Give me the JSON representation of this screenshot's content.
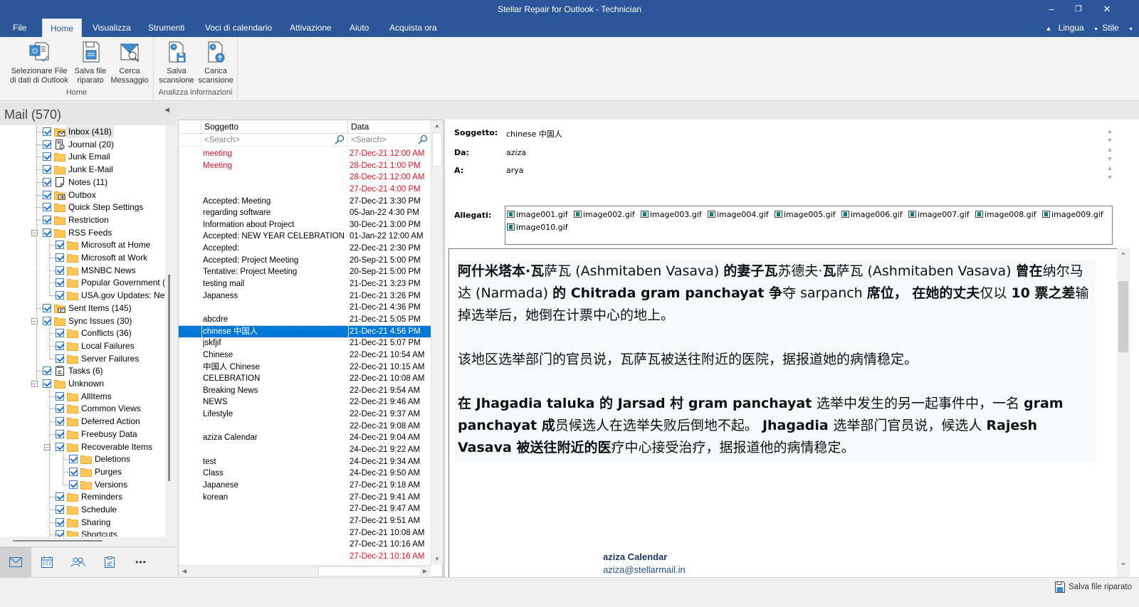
{
  "window": {
    "title": "Stellar Repair for Outlook - Technician",
    "minimize": "–",
    "restore": "❐",
    "close": "✕"
  },
  "menu": {
    "tabs": [
      {
        "label": "File",
        "active": false
      },
      {
        "label": "Home",
        "active": true
      },
      {
        "label": "Visualizza",
        "active": false
      },
      {
        "label": "Strumenti",
        "active": false
      },
      {
        "label": "Voci di calendario",
        "active": false
      },
      {
        "label": "Attivazione",
        "active": false
      },
      {
        "label": "Aiuto",
        "active": false
      },
      {
        "label": "Acquista ora",
        "active": false
      }
    ],
    "right": {
      "lingua": "Lingua",
      "stile": "Stile"
    }
  },
  "ribbon": {
    "groups": [
      {
        "label": "Home",
        "buttons": [
          {
            "line1": "Selezionare File",
            "line2": "di dati di Outlook",
            "icon": "outlook-file-icon"
          },
          {
            "line1": "Salva file",
            "line2": "riparato",
            "icon": "save-file-icon"
          },
          {
            "line1": "Cerca",
            "line2": "Messaggio",
            "icon": "search-message-icon"
          }
        ]
      },
      {
        "label": "Analizza informazioni",
        "buttons": [
          {
            "line1": "Salva",
            "line2": "scansione",
            "icon": "save-scan-icon"
          },
          {
            "line1": "Carica",
            "line2": "scansione",
            "icon": "load-scan-icon"
          }
        ]
      }
    ]
  },
  "left": {
    "header": "Mail (570)",
    "tree": [
      {
        "label": "Inbox (418)",
        "level": 1,
        "icon": "inbox-folder-icon",
        "selected": true
      },
      {
        "label": "Journal (20)",
        "level": 1,
        "icon": "journal-icon"
      },
      {
        "label": "Junk Email",
        "level": 1,
        "icon": "folder-icon"
      },
      {
        "label": "Junk E-Mail",
        "level": 1,
        "icon": "folder-icon"
      },
      {
        "label": "Notes (11)",
        "level": 1,
        "icon": "notes-icon"
      },
      {
        "label": "Outbox",
        "level": 1,
        "icon": "outbox-folder-icon"
      },
      {
        "label": "Quick Step Settings",
        "level": 1,
        "icon": "folder-icon"
      },
      {
        "label": "Restriction",
        "level": 1,
        "icon": "folder-icon"
      },
      {
        "label": "RSS Feeds",
        "level": 1,
        "icon": "folder-icon",
        "expanded": true
      },
      {
        "label": "Microsoft at Home",
        "level": 2,
        "icon": "folder-icon"
      },
      {
        "label": "Microsoft at Work",
        "level": 2,
        "icon": "folder-icon"
      },
      {
        "label": "MSNBC News",
        "level": 2,
        "icon": "folder-icon"
      },
      {
        "label": "Popular Government (",
        "level": 2,
        "icon": "folder-icon"
      },
      {
        "label": "USA.gov Updates: New",
        "level": 2,
        "icon": "folder-icon"
      },
      {
        "label": "Sent Items (145)",
        "level": 1,
        "icon": "sent-folder-icon"
      },
      {
        "label": "Sync Issues (30)",
        "level": 1,
        "icon": "folder-icon",
        "expanded": true
      },
      {
        "label": "Conflicts (36)",
        "level": 2,
        "icon": "folder-icon"
      },
      {
        "label": "Local Failures",
        "level": 2,
        "icon": "folder-icon"
      },
      {
        "label": "Server Failures",
        "level": 2,
        "icon": "folder-icon"
      },
      {
        "label": "Tasks (6)",
        "level": 1,
        "icon": "tasks-icon"
      },
      {
        "label": "Unknown",
        "level": 1,
        "icon": "folder-icon",
        "expanded": true
      },
      {
        "label": "AllItems",
        "level": 2,
        "icon": "folder-icon"
      },
      {
        "label": "Common Views",
        "level": 2,
        "icon": "folder-icon"
      },
      {
        "label": "Deferred Action",
        "level": 2,
        "icon": "folder-icon"
      },
      {
        "label": "Freebusy Data",
        "level": 2,
        "icon": "folder-icon"
      },
      {
        "label": "Recoverable Items",
        "level": 2,
        "icon": "folder-icon",
        "expanded": true
      },
      {
        "label": "Deletions",
        "level": 3,
        "icon": "folder-icon"
      },
      {
        "label": "Purges",
        "level": 3,
        "icon": "folder-icon"
      },
      {
        "label": "Versions",
        "level": 3,
        "icon": "folder-icon"
      },
      {
        "label": "Reminders",
        "level": 2,
        "icon": "folder-icon"
      },
      {
        "label": "Schedule",
        "level": 2,
        "icon": "folder-icon"
      },
      {
        "label": "Sharing",
        "level": 2,
        "icon": "folder-icon"
      },
      {
        "label": "Shortcuts",
        "level": 2,
        "icon": "folder-icon"
      }
    ],
    "nav": [
      "mail-icon",
      "calendar-icon",
      "contacts-icon",
      "tasks-icon",
      "more-icon"
    ],
    "more_label": "•••"
  },
  "list": {
    "columns": {
      "subject": "Soggetto",
      "date": "Data"
    },
    "search_placeholder": "<Search>",
    "rows": [
      {
        "subject": "meeting",
        "date": "27-Dec-21 12:00 AM",
        "red": true
      },
      {
        "subject": "Meeting",
        "date": "28-Dec-21 1:00 PM",
        "red": true
      },
      {
        "subject": "",
        "date": "28-Dec-21 12:00 AM",
        "red": true
      },
      {
        "subject": "",
        "date": "27-Dec-21 4:00 PM",
        "red": true
      },
      {
        "subject": "Accepted: Meeting",
        "date": "27-Dec-21 3:30 PM"
      },
      {
        "subject": "regarding software",
        "date": "05-Jan-22 4:30 PM"
      },
      {
        "subject": "Information about Project",
        "date": "30-Dec-21 3:00 PM"
      },
      {
        "subject": "Accepted: NEW YEAR CELEBRATION",
        "date": "01-Jan-22 12:00 AM"
      },
      {
        "subject": "Accepted:",
        "date": "22-Dec-21 2:30 PM"
      },
      {
        "subject": "Accepted: Project Meeting",
        "date": "20-Sep-21 5:00 PM"
      },
      {
        "subject": "Tentative: Project Meeting",
        "date": "20-Sep-21 5:00 PM"
      },
      {
        "subject": "testing mail",
        "date": "21-Dec-21 3:23 PM"
      },
      {
        "subject": "Japaness",
        "date": "21-Dec-21 3:26 PM"
      },
      {
        "subject": "",
        "date": "21-Dec-21 4:36 PM"
      },
      {
        "subject": "abcdre",
        "date": "21-Dec-21 5:05 PM"
      },
      {
        "subject": "chinese  中国人",
        "date": "21-Dec-21 4:56 PM",
        "selected": true
      },
      {
        "subject": "jskfjif",
        "date": "21-Dec-21 5:07 PM"
      },
      {
        "subject": "Chinese",
        "date": "22-Dec-21 10:54 AM"
      },
      {
        "subject": "中国人    Chinese",
        "date": "22-Dec-21 10:15 AM"
      },
      {
        "subject": "CELEBRATION",
        "date": "22-Dec-21 10:08 AM"
      },
      {
        "subject": "Breaking News",
        "date": "22-Dec-21 9:54 AM"
      },
      {
        "subject": "NEWS",
        "date": "22-Dec-21 9:46 AM"
      },
      {
        "subject": "Lifestyle",
        "date": "22-Dec-21 9:37 AM"
      },
      {
        "subject": "",
        "date": "22-Dec-21 9:08 AM"
      },
      {
        "subject": "aziza Calendar",
        "date": "24-Dec-21 9:04 AM"
      },
      {
        "subject": "",
        "date": "24-Dec-21 9:22 AM"
      },
      {
        "subject": "test",
        "date": "24-Dec-21 9:34 AM"
      },
      {
        "subject": "Class",
        "date": "24-Dec-21 9:50 AM"
      },
      {
        "subject": "Japanese",
        "date": "27-Dec-21 9:18 AM"
      },
      {
        "subject": "korean",
        "date": "27-Dec-21 9:41 AM"
      },
      {
        "subject": "",
        "date": "27-Dec-21 9:47 AM"
      },
      {
        "subject": "",
        "date": "27-Dec-21 9:51 AM"
      },
      {
        "subject": "",
        "date": "27-Dec-21 10:08 AM"
      },
      {
        "subject": "",
        "date": "27-Dec-21 10:16 AM"
      },
      {
        "subject": "",
        "date": "27-Dec-21 10:16 AM",
        "red": true
      }
    ]
  },
  "message": {
    "labels": {
      "subject": "Soggetto:",
      "from": "Da:",
      "to": "A:",
      "attachments": "Allegati:"
    },
    "subject": "chinese  中国人",
    "from": "aziza",
    "to": "arya",
    "attachments": [
      "image001.gif",
      "image002.gif",
      "image003.gif",
      "image004.gif",
      "image005.gif",
      "image006.gif",
      "image007.gif",
      "image008.gif",
      "image009.gif",
      "image010.gif"
    ],
    "body": {
      "p1": [
        {
          "t": "阿什米塔本·瓦",
          "b": true
        },
        {
          "t": "萨瓦 (Ashmitaben Vasava) ",
          "b": false
        },
        {
          "t": "的妻子瓦",
          "b": true
        },
        {
          "t": "苏德夫·",
          "b": false
        },
        {
          "t": "瓦",
          "b": true
        },
        {
          "t": "萨瓦 (Ashmitaben Vasava) ",
          "b": false
        },
        {
          "t": "曾在",
          "b": true
        },
        {
          "t": "纳尔马达 (Narmada) ",
          "b": false
        },
        {
          "t": "的 Chitrada gram panchayat 争",
          "b": true
        },
        {
          "t": "夺 sarpanch ",
          "b": false
        },
        {
          "t": "席位， 在她的丈夫",
          "b": true
        },
        {
          "t": "仅以 ",
          "b": false
        },
        {
          "t": "10 票之差",
          "b": true
        },
        {
          "t": "输掉选举后，她倒在计票中心的地上。",
          "b": false
        }
      ],
      "p2": [
        {
          "t": "该地区选举部门的官员说，瓦萨瓦被送往附近的医院，据报道她的病情稳定。",
          "b": false
        }
      ],
      "p3": [
        {
          "t": "在 Jhagadia taluka 的 Jarsad 村 gram panchayat ",
          "b": true
        },
        {
          "t": "选举中发生的另一起事件中，一名 ",
          "b": false
        },
        {
          "t": "gram panchayat 成",
          "b": true
        },
        {
          "t": "员候选人在选举失败后倒地不起。 ",
          "b": false
        },
        {
          "t": "Jhagadia ",
          "b": true
        },
        {
          "t": "选举部门官员说，候选人 ",
          "b": false
        },
        {
          "t": "Rajesh Vasava 被送往附近的医",
          "b": true
        },
        {
          "t": "疗中心接受治疗，据报道他的病情稳定。",
          "b": false
        }
      ]
    },
    "signature": {
      "name": "aziza Calendar",
      "email": "aziza@stellarmail.in"
    }
  },
  "status": {
    "save_label": "Salva file riparato"
  },
  "colors": {
    "brand": "#2b579a",
    "selection": "#0078d7",
    "unread_red": "#e81123",
    "folder": "#ffc65a"
  }
}
